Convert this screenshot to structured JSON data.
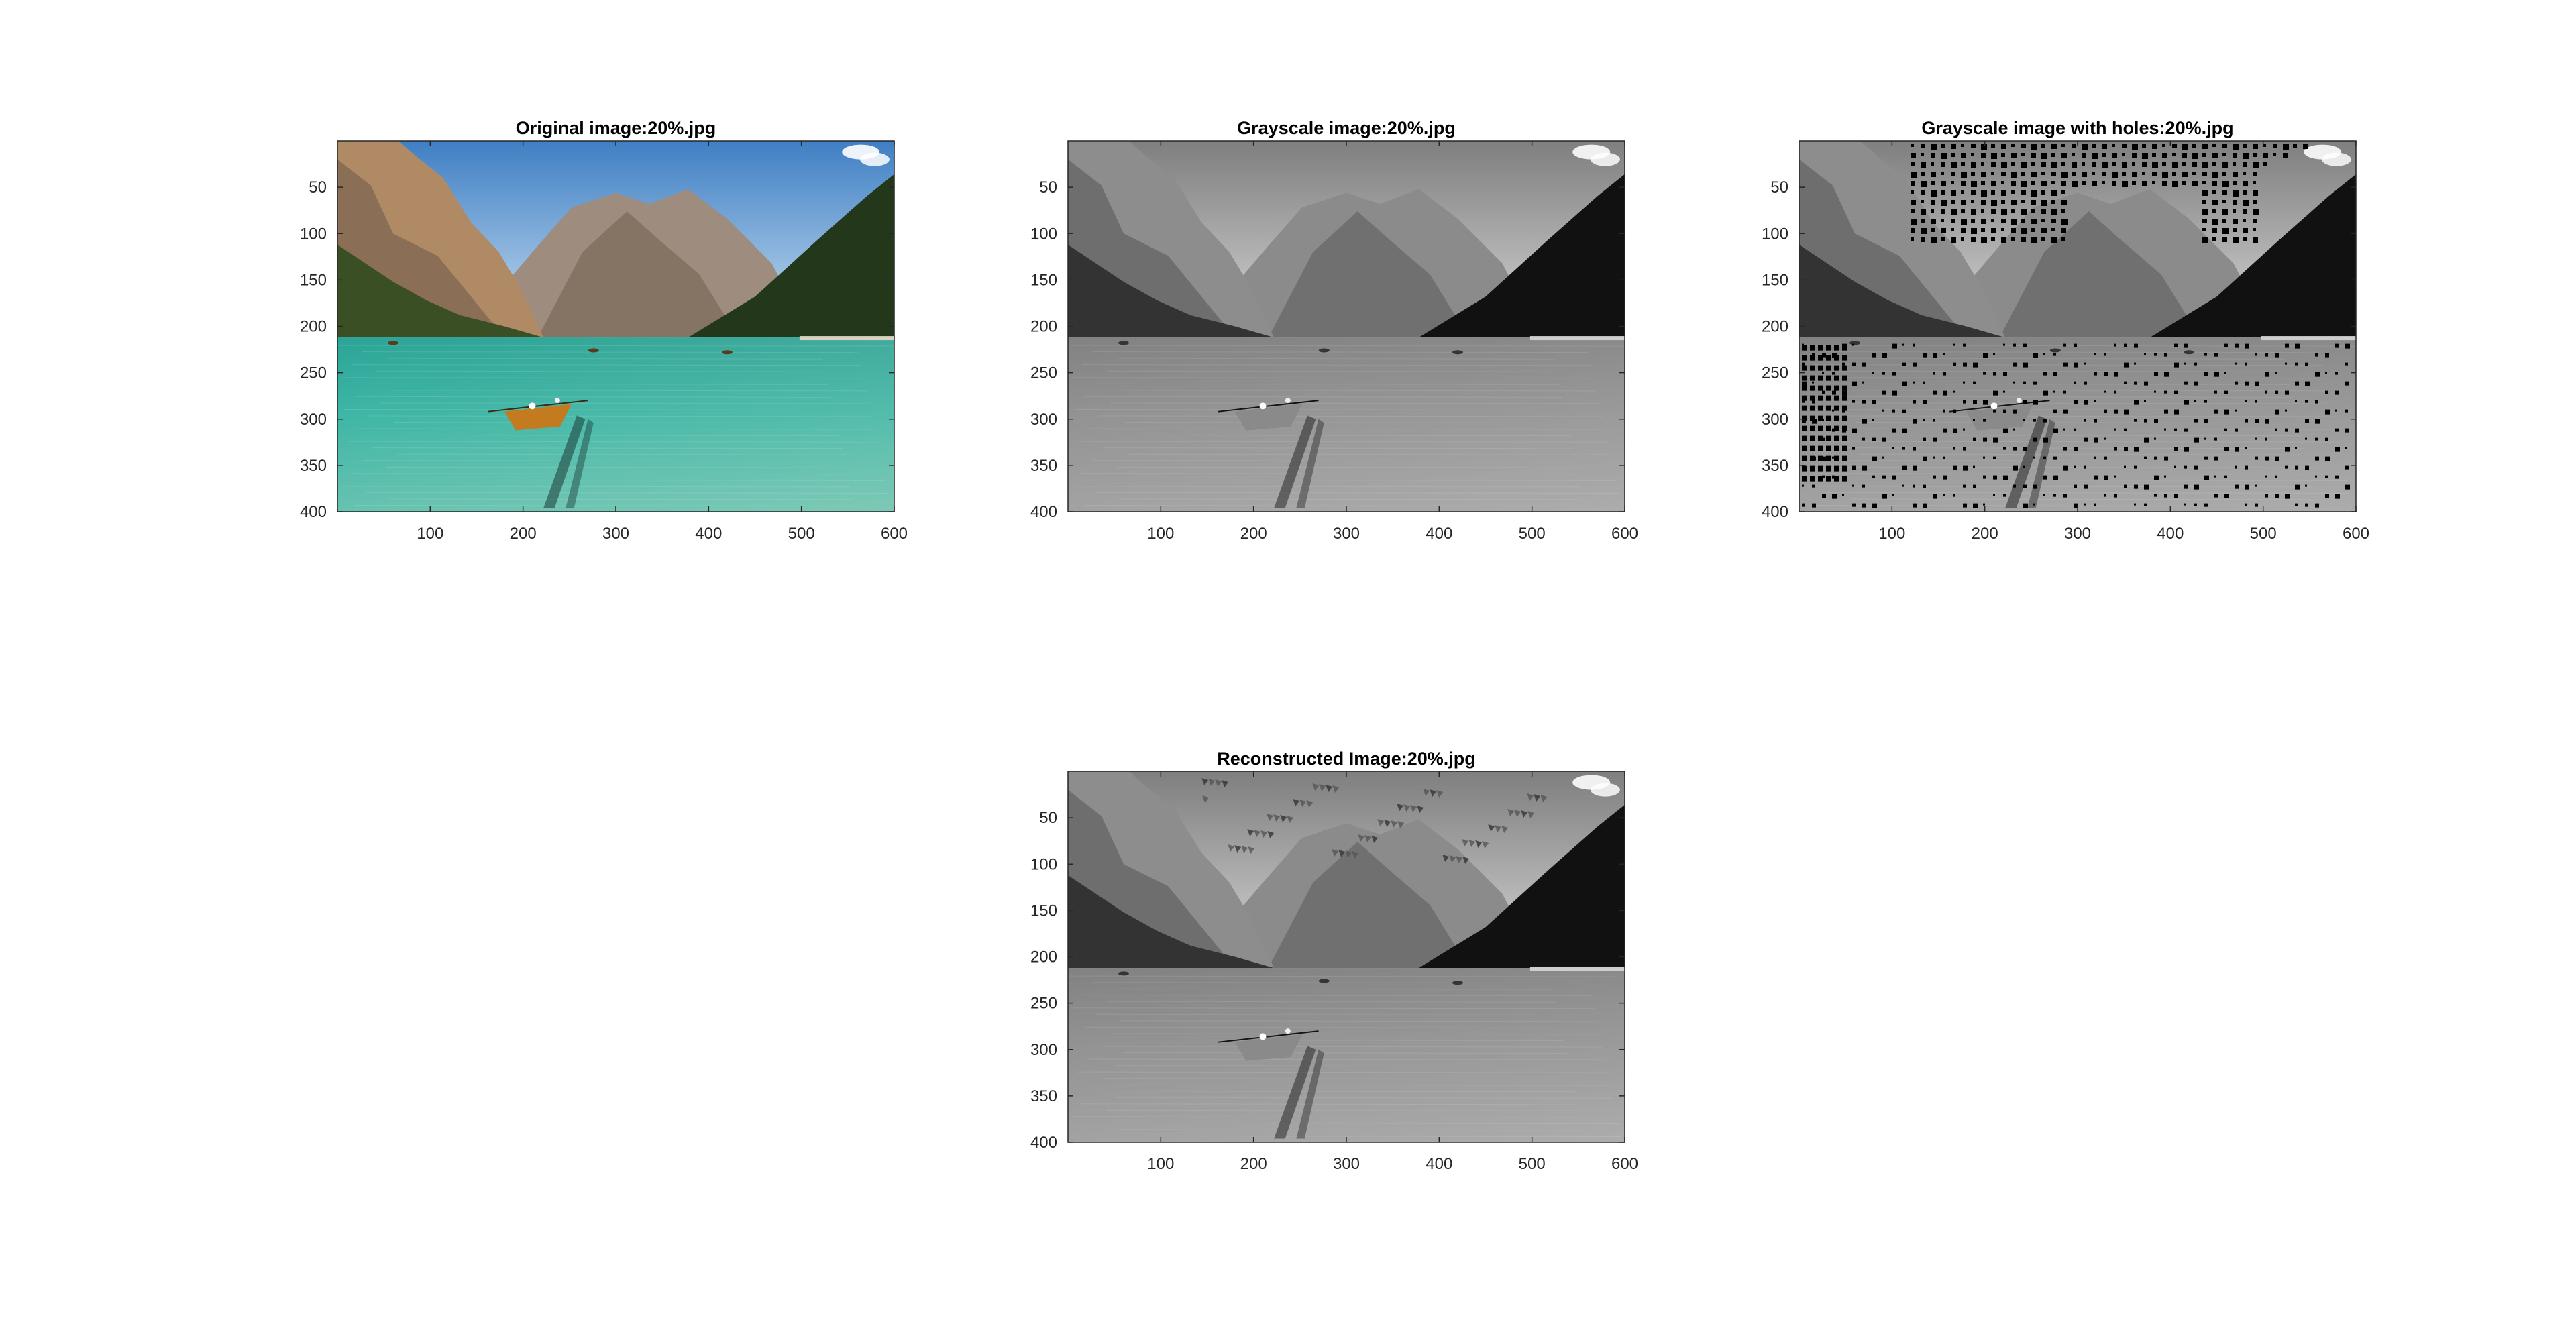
{
  "figure": {
    "background": "#ffffff",
    "axis_color": "#262626"
  },
  "panels": [
    {
      "id": "original",
      "title": "Original image:20%.jpg",
      "mode": "color",
      "holes": false,
      "artifacts": false
    },
    {
      "id": "grayscale",
      "title": "Grayscale image:20%.jpg",
      "mode": "gray",
      "holes": false,
      "artifacts": false
    },
    {
      "id": "holes",
      "title": "Grayscale image with holes:20%.jpg",
      "mode": "gray",
      "holes": true,
      "artifacts": false
    },
    {
      "id": "reconstructed",
      "title": "Reconstructed Image:20%.jpg",
      "mode": "gray",
      "holes": false,
      "artifacts": true
    }
  ],
  "axes": {
    "xlim": [
      0,
      600
    ],
    "ylim": [
      0,
      400
    ],
    "xticks": [
      100,
      200,
      300,
      400,
      500,
      600
    ],
    "yticks": [
      50,
      100,
      150,
      200,
      250,
      300,
      350,
      400
    ],
    "xtick_labels": [
      "100",
      "200",
      "300",
      "400",
      "500",
      "600"
    ],
    "ytick_labels": [
      "50",
      "100",
      "150",
      "200",
      "250",
      "300",
      "350",
      "400"
    ]
  },
  "colors": {
    "sky_top": "#3f7fc4",
    "sky_bottom": "#c8dff2",
    "cloud": "#ffffff",
    "mountain_far": "#9e8c7e",
    "mountain_near": "#b08a64",
    "cliff_shadow": "#6b5a4a",
    "forest_left": "#3b4f24",
    "forest_right": "#23381a",
    "water_deep": "#1f9a8e",
    "water_mid": "#3fb6a6",
    "water_light": "#7ec9b6",
    "shore": "#d9d2c0",
    "boat": "#c47a1e",
    "boat_shadow": "#1b3b36"
  }
}
